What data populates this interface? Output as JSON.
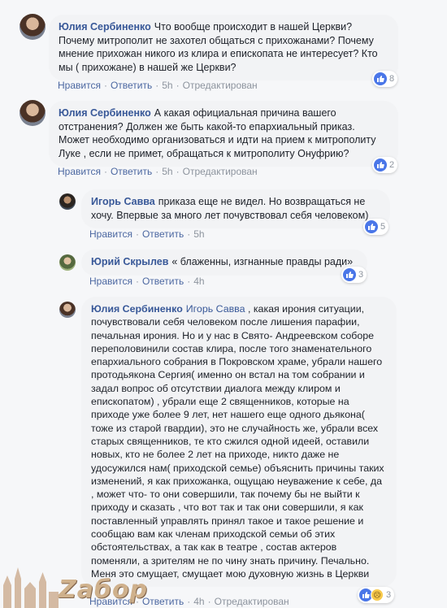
{
  "colors": {
    "author": "#385898",
    "bubble": "#f2f3f5",
    "link": "#4b67a1",
    "meta": "#8d949e",
    "like": "#4a76e8"
  },
  "comments": [
    {
      "author": "Юлия Сербиненко",
      "text": "Что вообще происходит в нашей Церкви? Почему митрополит не захотел общаться с прихожанами? Почему мнение прихожан никого из клира и епископата не интересует? Кто мы ( прихожане) в нашей же Церкви?",
      "like": "Нравится",
      "reply": "Ответить",
      "time": "5h",
      "edited": "Отредактирован",
      "reactions": "8"
    },
    {
      "author": "Юлия Сербиненко",
      "text": "А какая официальная причина вашего отстранения? Должен же быть какой-то епархиальный приказ. Может необходимо организоваться и идти на прием к митрополиту Луке , если не примет, обращаться к митрополиту Онуфрию?",
      "like": "Нравится",
      "reply": "Ответить",
      "time": "5h",
      "edited": "Отредактирован",
      "reactions": "2"
    },
    {
      "author": "Игорь Савва",
      "text": "приказа еще не видел. Но возвращаться не хочу. Впервые за много лет почувствовал себя человеком)",
      "like": "Нравится",
      "reply": "Ответить",
      "time": "5h",
      "reactions": "5"
    },
    {
      "author": "Юрий Скрылев",
      "text": "« блаженны, изгнанные правды ради»",
      "like": "Нравится",
      "reply": "Ответить",
      "time": "4h",
      "reactions": "3"
    },
    {
      "author": "Юлия Сербиненко",
      "mention": "Игорь Савва",
      "text": ", какая ирония ситуации, почувствовали себя человеком после лишения парафии, печальная ирония. Но и у нас в Свято- Андреевском соборе переполовинили состав клира, после того знаменательного епархиального собрания в Покровском храме, убрали нашего протодьякона Сергия( именно он встал на том собрании и задал вопрос об отсутствии диалога между клиром и епископатом) , убрали еще 2 священников, которые на приходе уже более 9 лет, нет нашего еще одного дьякона( тоже из старой гвардии), это не случайность же, убрали всех старых священников, те кто сжился одной идеей, оставили новых, кто не более 2 лет на приходе, никто даже не удосужился нам( приходской семье) объяснить причины таких изменений, я как прихожанка, ощущаю неуважение к себе, да , может что- то они совершили, так почему бы не выйти к приходу и сказать , что вот так и так они совершили, я как поставленный управлять принял такое и такое решение и сообщаю вам как членам приходской семьи об этих обстоятельствах, а так как в театре , состав актеров поменяли, а зрителям не по чину знать причину. Печально. Меня это смущает, смущает мою духовную жизнь в Церкви",
      "like": "Нравится",
      "reply": "Ответить",
      "time": "4h",
      "edited": "Отредактирован",
      "reactions": "3"
    }
  ],
  "watermark": {
    "text": "Zaбор"
  }
}
